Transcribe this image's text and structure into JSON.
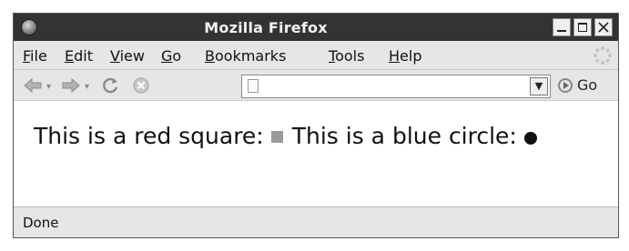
{
  "window": {
    "title": "Mozilla Firefox",
    "title_bar_color": "#333333"
  },
  "menubar": {
    "items": [
      {
        "underline": "F",
        "rest": "ile"
      },
      {
        "underline": "E",
        "rest": "dit"
      },
      {
        "underline": "V",
        "rest": "iew"
      },
      {
        "underline": "G",
        "rest": "o"
      },
      {
        "underline": "B",
        "rest": "ookmarks"
      },
      {
        "underline": "T",
        "rest": "ools"
      },
      {
        "underline": "H",
        "rest": "elp"
      }
    ]
  },
  "navbar": {
    "url_value": "",
    "go_label": "Go",
    "icons": [
      "back-icon",
      "forward-icon",
      "reload-icon",
      "stop-icon",
      "page-icon",
      "dropdown-icon",
      "go-icon"
    ]
  },
  "content": {
    "text_red": "This is a red square:",
    "text_blue": "This is a blue circle:"
  },
  "status": {
    "text": "Done"
  }
}
